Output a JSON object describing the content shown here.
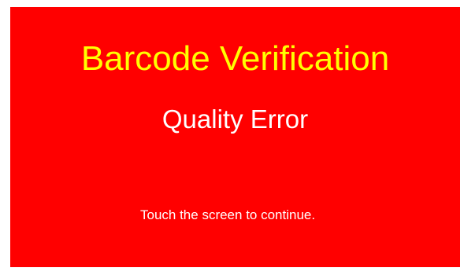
{
  "screen": {
    "title": "Barcode Verification",
    "status": "Quality Error",
    "prompt": "Touch the screen to continue.",
    "colors": {
      "background": "#ff0000",
      "title": "#ffff00",
      "text": "#ffffff"
    }
  }
}
